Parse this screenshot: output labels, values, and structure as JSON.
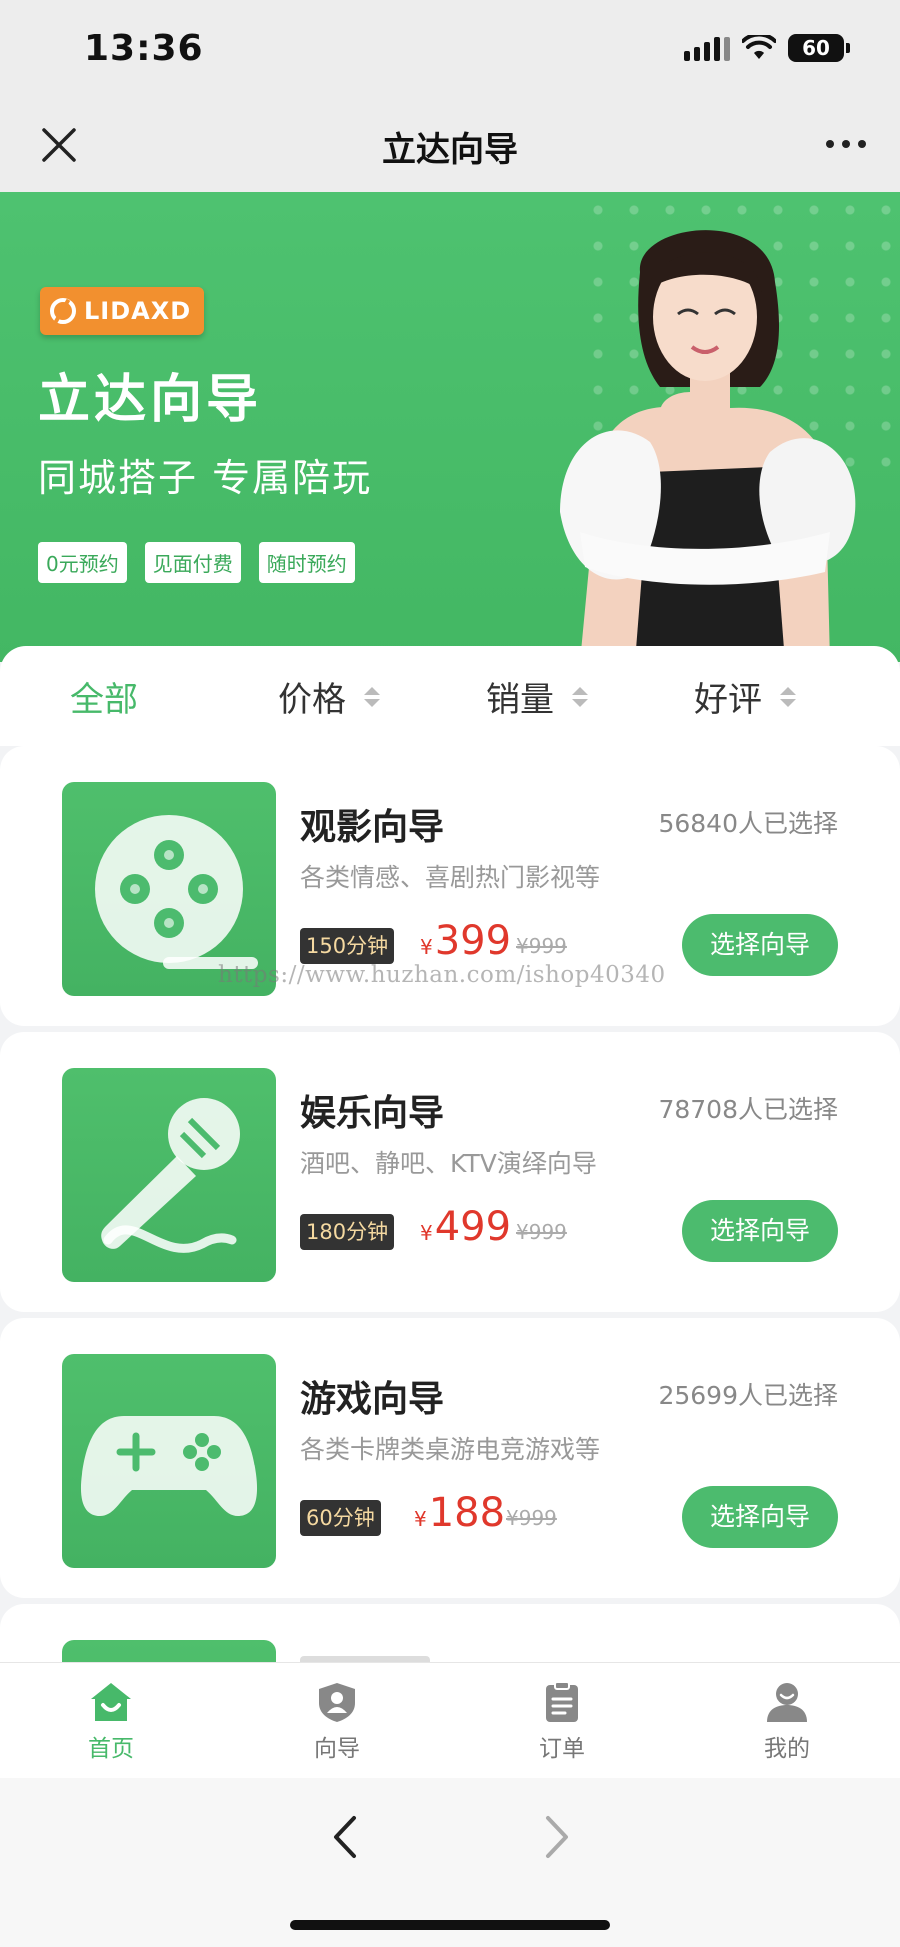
{
  "status_bar": {
    "time": "13:36",
    "battery": "60"
  },
  "nav": {
    "title": "立达向导"
  },
  "banner": {
    "logo_text": "LIDAXD",
    "title": "立达向导",
    "subtitle": "同城搭子 专属陪玩",
    "tags": [
      "0元预约",
      "见面付费",
      "随时预约"
    ]
  },
  "sort": {
    "items": [
      "全部",
      "价格",
      "销量",
      "好评"
    ],
    "active": "全部"
  },
  "cards": [
    {
      "title": "观影向导",
      "count": "56840人已选择",
      "desc": "各类情感、喜剧热门影视等",
      "duration": "150分钟",
      "price": "399",
      "original": "¥999",
      "button": "选择向导",
      "icon": "film-reel-icon"
    },
    {
      "title": "娱乐向导",
      "count": "78708人已选择",
      "desc": "酒吧、静吧、KTV演绎向导",
      "duration": "180分钟",
      "price": "499",
      "original": "¥999",
      "button": "选择向导",
      "icon": "microphone-icon"
    },
    {
      "title": "游戏向导",
      "count": "25699人已选择",
      "desc": "各类卡牌类桌游电竞游戏等",
      "duration": "60分钟",
      "price": "188",
      "original": "¥999",
      "button": "选择向导",
      "icon": "gamepad-icon"
    }
  ],
  "currency_symbol": "¥",
  "watermark": "https://www.huzhan.com/ishop40340",
  "tab_bar": {
    "items": [
      "首页",
      "向导",
      "订单",
      "我的"
    ],
    "active": "首页"
  },
  "colors": {
    "brand_green": "#4cbb6e",
    "price_red": "#e0382c",
    "logo_orange": "#f2902f"
  }
}
